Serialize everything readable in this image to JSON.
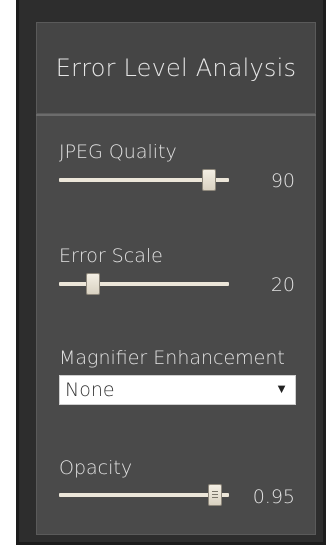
{
  "panel": {
    "title": "Error Level Analysis"
  },
  "jpeg_quality": {
    "label": "JPEG Quality",
    "value": "90",
    "slider_fraction": 0.88
  },
  "error_scale": {
    "label": "Error Scale",
    "value": "20",
    "slider_fraction": 0.2
  },
  "magnifier": {
    "label": "Magnifier Enhancement",
    "selected": "None",
    "arrow_icon": "triangle-down"
  },
  "opacity": {
    "label": "Opacity",
    "value": "0.95",
    "slider_fraction": 0.92
  },
  "colors": {
    "panel_bg": "#4a4a4a",
    "header_bg": "#454545",
    "text": "#e2e2e2",
    "track": "#ece6d9"
  }
}
